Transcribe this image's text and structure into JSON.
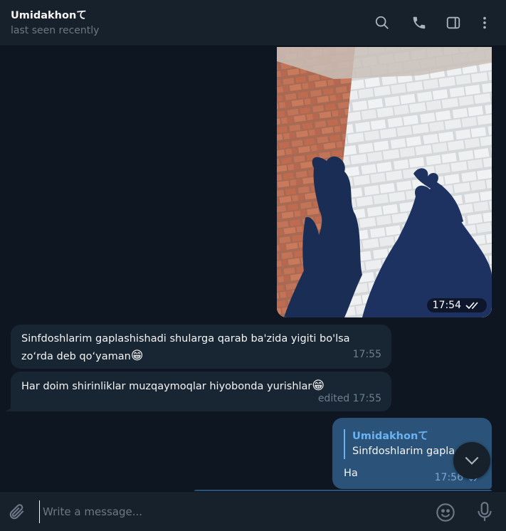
{
  "header": {
    "name": "Umidakhonて",
    "status": "last seen recently"
  },
  "messages": {
    "photo": {
      "time": "17:54"
    },
    "incoming": [
      {
        "text": "Sinfdoshlarim gaplashishadi shularga qarab ba'zida yigiti bo'lsa",
        "text2": "zo‘rda deb qo‘yaman",
        "emoji": "😁",
        "time": "17:55"
      },
      {
        "text": "Har doim shirinliklar muzqaymoqlar hiyobonda yurishlar",
        "emoji": "😁",
        "meta": "edited 17:55"
      }
    ],
    "outgoing": {
      "reply_author": "Umidakhonて",
      "reply_text": "Sinfdoshlarim gapla",
      "text": "Ha",
      "time": "17:56"
    }
  },
  "composer": {
    "placeholder": "Write a message..."
  },
  "colors": {
    "background": "#0e1621",
    "header": "#17212b",
    "incoming_bubble": "#182533",
    "outgoing_bubble": "#2b5278",
    "accent": "#6ab3f3"
  }
}
